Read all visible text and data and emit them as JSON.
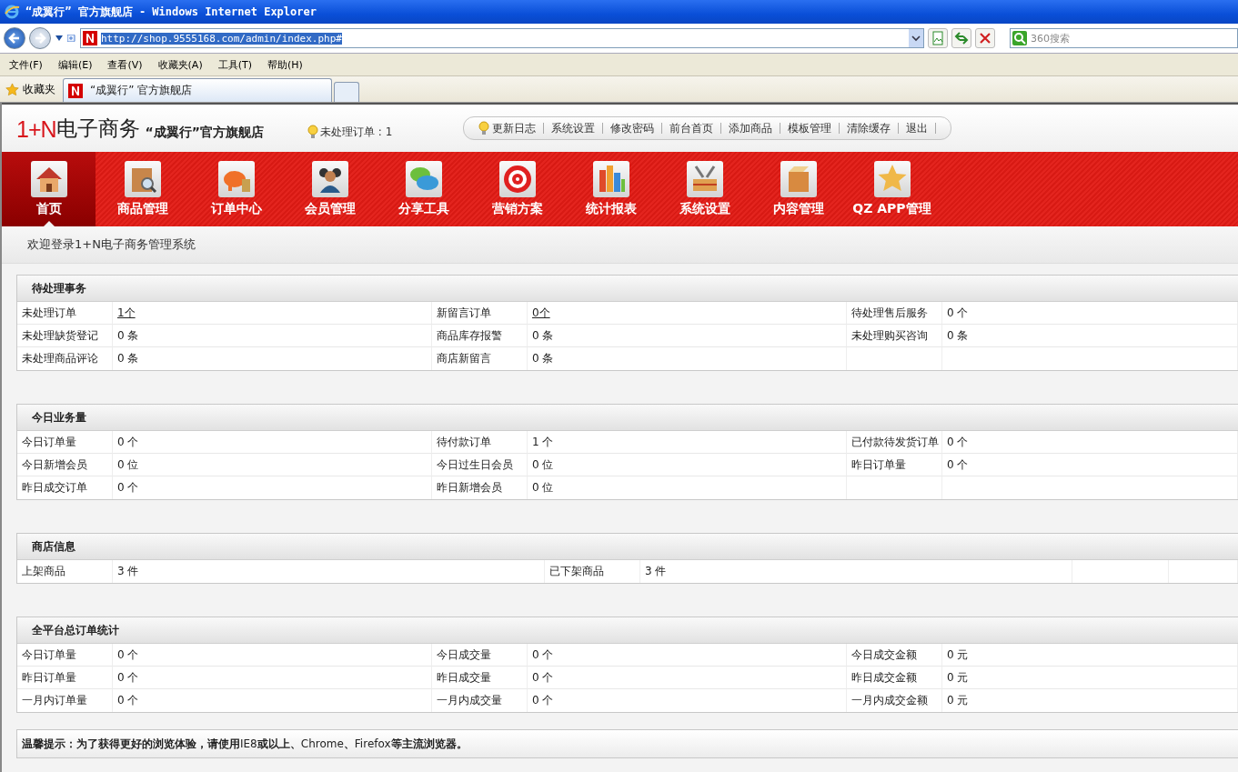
{
  "window": {
    "title": "“成翼行” 官方旗舰店 - Windows Internet Explorer"
  },
  "address_bar": {
    "value": "http://shop.9555168.com/admin/index.php#",
    "selected": true
  },
  "search": {
    "placeholder": "360搜索"
  },
  "menu": [
    "文件(F)",
    "编辑(E)",
    "查看(V)",
    "收藏夹(A)",
    "工具(T)",
    "帮助(H)"
  ],
  "favorites": {
    "label": "收藏夹"
  },
  "tabs": [
    {
      "label": "“成翼行” 官方旗舰店",
      "selected": true
    }
  ],
  "header": {
    "logo_mark": "1+N",
    "logo_text": "电子商务",
    "shop_name": "“成翼行”官方旗舰店",
    "notice": "未处理订单 : 1",
    "links": [
      "更新日志",
      "系统设置",
      "修改密码",
      "前台首页",
      "添加商品",
      "模板管理",
      "清除缓存",
      "退出"
    ]
  },
  "nav": [
    {
      "label": "首页",
      "selected": true
    },
    {
      "label": "商品管理",
      "selected": false
    },
    {
      "label": "订单中心",
      "selected": false
    },
    {
      "label": "会员管理",
      "selected": false
    },
    {
      "label": "分享工具",
      "selected": false
    },
    {
      "label": "营销方案",
      "selected": false
    },
    {
      "label": "统计报表",
      "selected": false
    },
    {
      "label": "系统设置",
      "selected": false
    },
    {
      "label": "内容管理",
      "selected": false
    },
    {
      "label": "QZ APP管理",
      "selected": false
    }
  ],
  "breadcrumb": "欢迎登录1+N电子商务管理系统",
  "sections": [
    {
      "title": "待处理事务",
      "rows": [
        [
          {
            "label": "未处理订单",
            "value": "1个",
            "link": true
          },
          {
            "label": "新留言订单",
            "value": "0个",
            "link": true
          },
          {
            "label": "待处理售后服务",
            "value": "0 个",
            "link": false
          }
        ],
        [
          {
            "label": "未处理缺货登记",
            "value": "0 条",
            "link": false
          },
          {
            "label": "商品库存报警",
            "value": "0 条",
            "link": false
          },
          {
            "label": "未处理购买咨询",
            "value": "0 条",
            "link": false
          }
        ],
        [
          {
            "label": "未处理商品评论",
            "value": "0 条",
            "link": false
          },
          {
            "label": "商店新留言",
            "value": "0 条",
            "link": false
          }
        ]
      ]
    },
    {
      "title": "今日业务量",
      "rows": [
        [
          {
            "label": "今日订单量",
            "value": "0 个",
            "link": false
          },
          {
            "label": "待付款订单",
            "value": "1 个",
            "link": false
          },
          {
            "label": "已付款待发货订单",
            "value": "0 个",
            "link": false
          }
        ],
        [
          {
            "label": "今日新增会员",
            "value": "0 位",
            "link": false
          },
          {
            "label": "今日过生日会员",
            "value": "0 位",
            "link": false
          },
          {
            "label": "昨日订单量",
            "value": "0 个",
            "link": false
          }
        ],
        [
          {
            "label": "昨日成交订单",
            "value": "0 个",
            "link": false
          },
          {
            "label": "昨日新增会员",
            "value": "0 位",
            "link": false
          }
        ]
      ]
    },
    {
      "title": "商店信息",
      "rows": [
        [
          {
            "label": "上架商品",
            "value": "3 件",
            "link": false
          },
          {
            "label": "已下架商品",
            "value": "3 件",
            "link": false
          }
        ]
      ]
    },
    {
      "title": "全平台总订单统计",
      "rows": [
        [
          {
            "label": "今日订单量",
            "value": "0 个",
            "link": false
          },
          {
            "label": "今日成交量",
            "value": "0 个",
            "link": false
          },
          {
            "label": "今日成交金额",
            "value": "0 元",
            "link": false
          }
        ],
        [
          {
            "label": "昨日订单量",
            "value": "0 个",
            "link": false
          },
          {
            "label": "昨日成交量",
            "value": "0 个",
            "link": false
          },
          {
            "label": "昨日成交金额",
            "value": "0 元",
            "link": false
          }
        ],
        [
          {
            "label": "一月内订单量",
            "value": "0 个",
            "link": false
          },
          {
            "label": "一月内成交量",
            "value": "0 个",
            "link": false
          },
          {
            "label": "一月内成交金额",
            "value": "0 元",
            "link": false
          }
        ]
      ]
    }
  ],
  "footer_tip": "**温馨提示：为了获得更好的浏览体验，请使用**IE8**或以上、**Chrome**、**Firefox**等主流浏览器。**"
}
